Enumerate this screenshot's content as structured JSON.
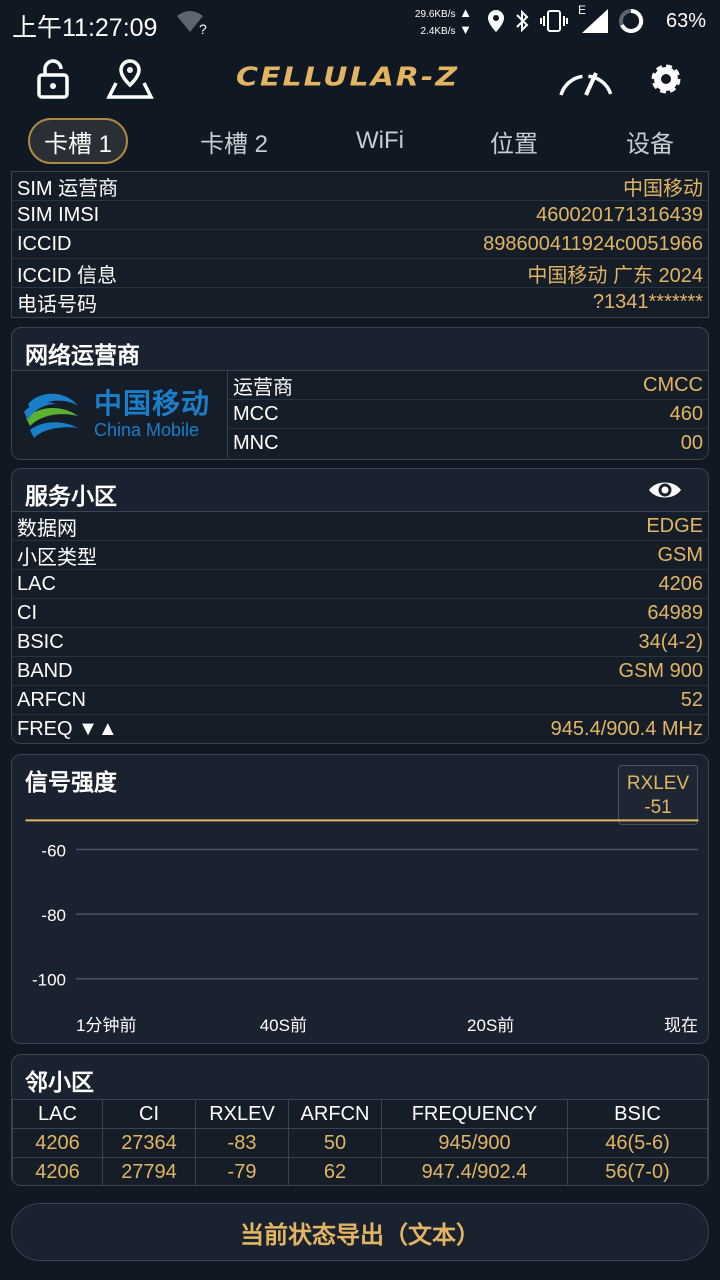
{
  "status_bar": {
    "time": "上午11:27:09",
    "wifi_badge": "?",
    "down_speed": "29.6KB/s",
    "up_speed": "2.4KB/s",
    "network_letter": "E",
    "battery": "63%",
    "icons": [
      "location-icon",
      "bluetooth-icon",
      "vibrate-icon",
      "signal-icon",
      "battery-ring-icon"
    ]
  },
  "header": {
    "logo": "CELLULAR-Z",
    "icons": [
      "lock-icon",
      "map-pin-icon",
      "gauge-icon",
      "gear-icon"
    ]
  },
  "tabs": [
    {
      "label": "卡槽 1",
      "active": true
    },
    {
      "label": "卡槽 2",
      "active": false
    },
    {
      "label": "WiFi",
      "active": false
    },
    {
      "label": "位置",
      "active": false
    },
    {
      "label": "设备",
      "active": false
    }
  ],
  "sim_info": [
    {
      "label": "SIM 运营商",
      "value": "中国移动"
    },
    {
      "label": "SIM IMSI",
      "value": "460020171316439"
    },
    {
      "label": "ICCID",
      "value": "898600411924c0051966"
    },
    {
      "label": "ICCID 信息",
      "value": "中国移动 广东 2024"
    },
    {
      "label": "电话号码",
      "value": "?1341*******"
    }
  ],
  "network_operator": {
    "title": "网络运营商",
    "logo_cn": "中国移动",
    "logo_en": "China Mobile",
    "rows": [
      {
        "label": "运营商",
        "value": "CMCC"
      },
      {
        "label": "MCC",
        "value": "460"
      },
      {
        "label": "MNC",
        "value": "00"
      }
    ]
  },
  "serving_cell": {
    "title": "服务小区",
    "rows": [
      {
        "label": "数据网",
        "value": "EDGE"
      },
      {
        "label": "小区类型",
        "value": "GSM"
      },
      {
        "label": "LAC",
        "value": "4206"
      },
      {
        "label": "CI",
        "value": "64989"
      },
      {
        "label": "BSIC",
        "value": "34(4-2)"
      },
      {
        "label": "BAND",
        "value": "GSM 900"
      },
      {
        "label": "ARFCN",
        "value": "52"
      },
      {
        "label": "FREQ ▼▲",
        "value": "945.4/900.4 MHz"
      }
    ]
  },
  "signal": {
    "title": "信号强度",
    "badge_label": "RXLEV",
    "badge_value": "-51",
    "line_color": "#e3b562",
    "y_ticks": [
      "-60",
      "-80",
      "-100"
    ],
    "x_ticks": [
      "1分钟前",
      "40S前",
      "20S前",
      "现在"
    ]
  },
  "chart_data": {
    "type": "line",
    "title": "信号强度",
    "x": [
      "1分钟前",
      "40S前",
      "20S前",
      "现在"
    ],
    "series": [
      {
        "name": "RXLEV",
        "values": [
          -51,
          -51,
          -51,
          -51
        ]
      }
    ],
    "ylim": [
      -110,
      -45
    ],
    "y_ticks": [
      -60,
      -80,
      -100
    ],
    "grid": true
  },
  "neighbors": {
    "title": "邻小区",
    "headers": [
      "LAC",
      "CI",
      "RXLEV",
      "ARFCN",
      "FREQUENCY",
      "BSIC"
    ],
    "rows": [
      [
        "4206",
        "27364",
        "-83",
        "50",
        "945/900",
        "46(5-6)"
      ],
      [
        "4206",
        "27794",
        "-79",
        "62",
        "947.4/902.4",
        "56(7-0)"
      ]
    ]
  },
  "export_button": "当前状态导出（文本）"
}
